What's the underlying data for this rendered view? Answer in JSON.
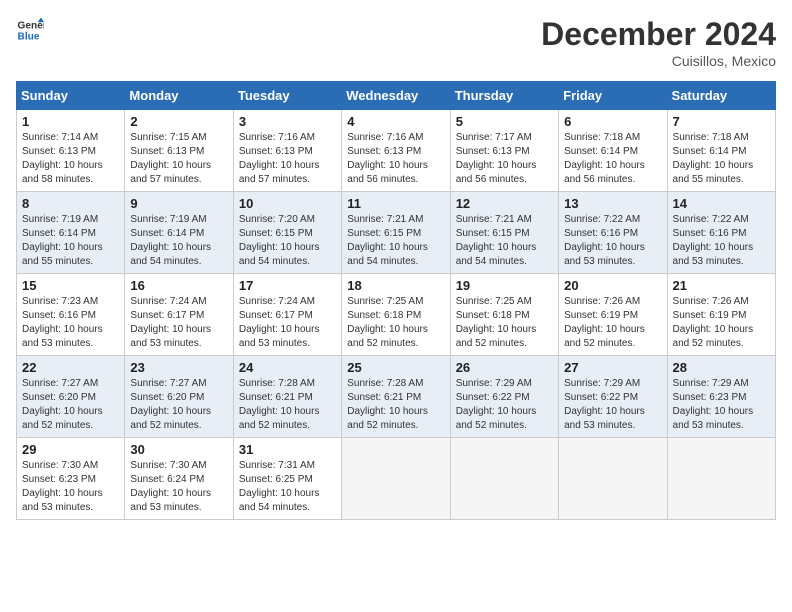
{
  "logo": {
    "line1": "General",
    "line2": "Blue"
  },
  "title": "December 2024",
  "location": "Cuisillos, Mexico",
  "weekdays": [
    "Sunday",
    "Monday",
    "Tuesday",
    "Wednesday",
    "Thursday",
    "Friday",
    "Saturday"
  ],
  "weeks": [
    [
      {
        "day": "1",
        "sunrise": "7:14 AM",
        "sunset": "6:13 PM",
        "daylight": "10 hours and 58 minutes."
      },
      {
        "day": "2",
        "sunrise": "7:15 AM",
        "sunset": "6:13 PM",
        "daylight": "10 hours and 57 minutes."
      },
      {
        "day": "3",
        "sunrise": "7:16 AM",
        "sunset": "6:13 PM",
        "daylight": "10 hours and 57 minutes."
      },
      {
        "day": "4",
        "sunrise": "7:16 AM",
        "sunset": "6:13 PM",
        "daylight": "10 hours and 56 minutes."
      },
      {
        "day": "5",
        "sunrise": "7:17 AM",
        "sunset": "6:13 PM",
        "daylight": "10 hours and 56 minutes."
      },
      {
        "day": "6",
        "sunrise": "7:18 AM",
        "sunset": "6:14 PM",
        "daylight": "10 hours and 56 minutes."
      },
      {
        "day": "7",
        "sunrise": "7:18 AM",
        "sunset": "6:14 PM",
        "daylight": "10 hours and 55 minutes."
      }
    ],
    [
      {
        "day": "8",
        "sunrise": "7:19 AM",
        "sunset": "6:14 PM",
        "daylight": "10 hours and 55 minutes."
      },
      {
        "day": "9",
        "sunrise": "7:19 AM",
        "sunset": "6:14 PM",
        "daylight": "10 hours and 54 minutes."
      },
      {
        "day": "10",
        "sunrise": "7:20 AM",
        "sunset": "6:15 PM",
        "daylight": "10 hours and 54 minutes."
      },
      {
        "day": "11",
        "sunrise": "7:21 AM",
        "sunset": "6:15 PM",
        "daylight": "10 hours and 54 minutes."
      },
      {
        "day": "12",
        "sunrise": "7:21 AM",
        "sunset": "6:15 PM",
        "daylight": "10 hours and 54 minutes."
      },
      {
        "day": "13",
        "sunrise": "7:22 AM",
        "sunset": "6:16 PM",
        "daylight": "10 hours and 53 minutes."
      },
      {
        "day": "14",
        "sunrise": "7:22 AM",
        "sunset": "6:16 PM",
        "daylight": "10 hours and 53 minutes."
      }
    ],
    [
      {
        "day": "15",
        "sunrise": "7:23 AM",
        "sunset": "6:16 PM",
        "daylight": "10 hours and 53 minutes."
      },
      {
        "day": "16",
        "sunrise": "7:24 AM",
        "sunset": "6:17 PM",
        "daylight": "10 hours and 53 minutes."
      },
      {
        "day": "17",
        "sunrise": "7:24 AM",
        "sunset": "6:17 PM",
        "daylight": "10 hours and 53 minutes."
      },
      {
        "day": "18",
        "sunrise": "7:25 AM",
        "sunset": "6:18 PM",
        "daylight": "10 hours and 52 minutes."
      },
      {
        "day": "19",
        "sunrise": "7:25 AM",
        "sunset": "6:18 PM",
        "daylight": "10 hours and 52 minutes."
      },
      {
        "day": "20",
        "sunrise": "7:26 AM",
        "sunset": "6:19 PM",
        "daylight": "10 hours and 52 minutes."
      },
      {
        "day": "21",
        "sunrise": "7:26 AM",
        "sunset": "6:19 PM",
        "daylight": "10 hours and 52 minutes."
      }
    ],
    [
      {
        "day": "22",
        "sunrise": "7:27 AM",
        "sunset": "6:20 PM",
        "daylight": "10 hours and 52 minutes."
      },
      {
        "day": "23",
        "sunrise": "7:27 AM",
        "sunset": "6:20 PM",
        "daylight": "10 hours and 52 minutes."
      },
      {
        "day": "24",
        "sunrise": "7:28 AM",
        "sunset": "6:21 PM",
        "daylight": "10 hours and 52 minutes."
      },
      {
        "day": "25",
        "sunrise": "7:28 AM",
        "sunset": "6:21 PM",
        "daylight": "10 hours and 52 minutes."
      },
      {
        "day": "26",
        "sunrise": "7:29 AM",
        "sunset": "6:22 PM",
        "daylight": "10 hours and 52 minutes."
      },
      {
        "day": "27",
        "sunrise": "7:29 AM",
        "sunset": "6:22 PM",
        "daylight": "10 hours and 53 minutes."
      },
      {
        "day": "28",
        "sunrise": "7:29 AM",
        "sunset": "6:23 PM",
        "daylight": "10 hours and 53 minutes."
      }
    ],
    [
      {
        "day": "29",
        "sunrise": "7:30 AM",
        "sunset": "6:23 PM",
        "daylight": "10 hours and 53 minutes."
      },
      {
        "day": "30",
        "sunrise": "7:30 AM",
        "sunset": "6:24 PM",
        "daylight": "10 hours and 53 minutes."
      },
      {
        "day": "31",
        "sunrise": "7:31 AM",
        "sunset": "6:25 PM",
        "daylight": "10 hours and 54 minutes."
      },
      null,
      null,
      null,
      null
    ]
  ]
}
